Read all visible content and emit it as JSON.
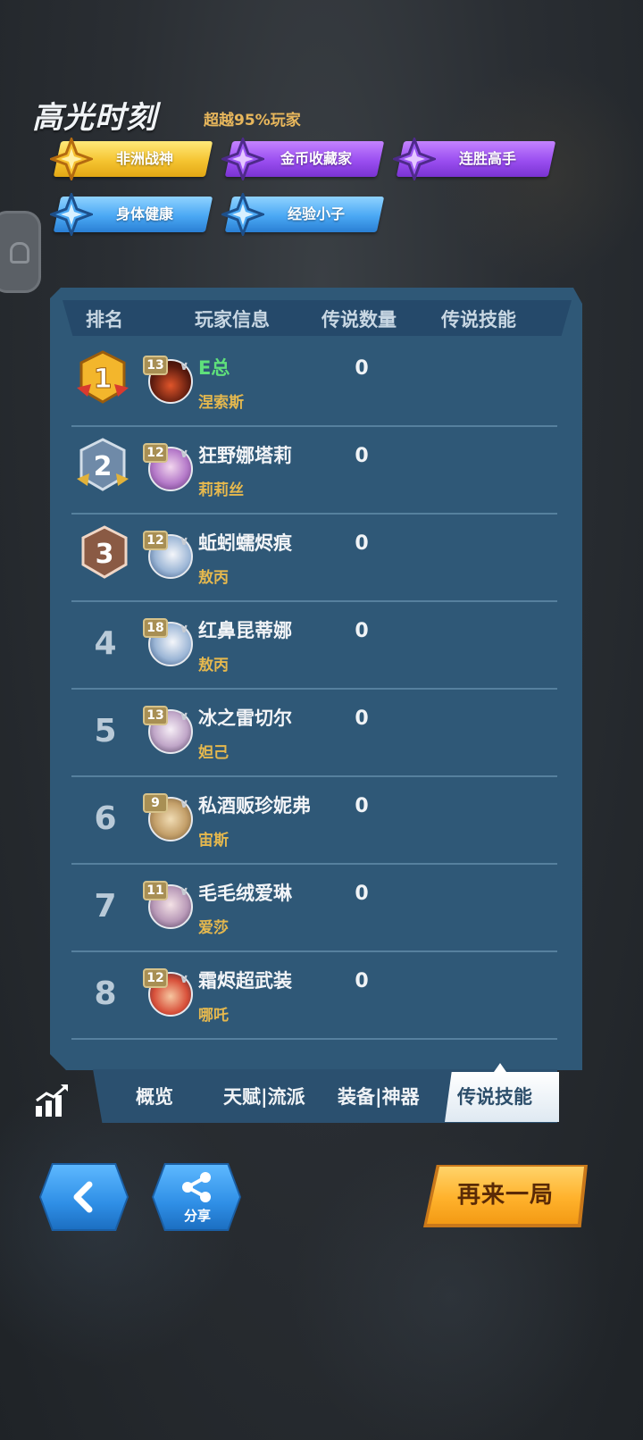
{
  "highlight": {
    "title": "高光时刻",
    "subtitle": "超越95%玩家",
    "badges": [
      {
        "label": "非洲战神",
        "style": "gold",
        "icon": "gold-star-icon"
      },
      {
        "label": "金币收藏家",
        "style": "purple",
        "icon": "purple-star-icon"
      },
      {
        "label": "连胜高手",
        "style": "purple",
        "icon": "purple-star-icon"
      },
      {
        "label": "身体健康",
        "style": "blue",
        "icon": "blue-star-icon"
      },
      {
        "label": "经验小子",
        "style": "blue",
        "icon": "blue-star-icon"
      }
    ]
  },
  "table": {
    "headers": [
      "排名",
      "玩家信息",
      "传说数量",
      "传说技能"
    ],
    "rows": [
      {
        "rank": "1",
        "level": "13",
        "name": "E总",
        "hero": "涅索斯",
        "legend_count": "0",
        "name_color": "green"
      },
      {
        "rank": "2",
        "level": "12",
        "name": "狂野娜塔莉",
        "hero": "莉莉丝",
        "legend_count": "0"
      },
      {
        "rank": "3",
        "level": "12",
        "name": "蚯蚓蠕烬痕",
        "hero": "敖丙",
        "legend_count": "0"
      },
      {
        "rank": "4",
        "level": "18",
        "name": "红鼻昆蒂娜",
        "hero": "敖丙",
        "legend_count": "0"
      },
      {
        "rank": "5",
        "level": "13",
        "name": "冰之雷切尔",
        "hero": "妲己",
        "legend_count": "0"
      },
      {
        "rank": "6",
        "level": "9",
        "name": "私酒贩珍妮弗",
        "hero": "宙斯",
        "legend_count": "0"
      },
      {
        "rank": "7",
        "level": "11",
        "name": "毛毛绒爱琳",
        "hero": "爱莎",
        "legend_count": "0"
      },
      {
        "rank": "8",
        "level": "12",
        "name": "霜烬超武装",
        "hero": "哪吒",
        "legend_count": "0"
      }
    ]
  },
  "tabs": {
    "overview": "概览",
    "talent": "天赋|流派",
    "equipment": "装备|神器",
    "legend_skill": "传说技能",
    "active": "传说技能"
  },
  "actions": {
    "share": "分享",
    "play_again": "再来一局"
  },
  "colors": {
    "panel": "#2f5877",
    "accent_gold": "#e5b84e",
    "winner_name": "#5fe07b",
    "play_again": "#ffb22c"
  }
}
